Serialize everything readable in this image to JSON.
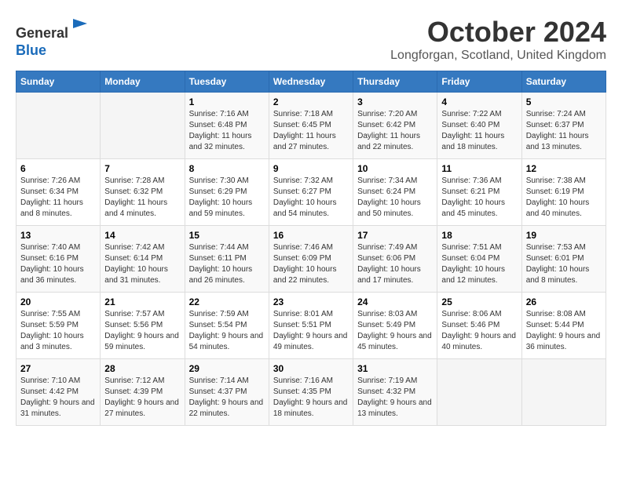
{
  "header": {
    "logo_line1": "General",
    "logo_line2": "Blue",
    "month_title": "October 2024",
    "location": "Longforgan, Scotland, United Kingdom"
  },
  "weekdays": [
    "Sunday",
    "Monday",
    "Tuesday",
    "Wednesday",
    "Thursday",
    "Friday",
    "Saturday"
  ],
  "weeks": [
    [
      {
        "day": "",
        "sunrise": "",
        "sunset": "",
        "daylight": ""
      },
      {
        "day": "",
        "sunrise": "",
        "sunset": "",
        "daylight": ""
      },
      {
        "day": "1",
        "sunrise": "Sunrise: 7:16 AM",
        "sunset": "Sunset: 6:48 PM",
        "daylight": "Daylight: 11 hours and 32 minutes."
      },
      {
        "day": "2",
        "sunrise": "Sunrise: 7:18 AM",
        "sunset": "Sunset: 6:45 PM",
        "daylight": "Daylight: 11 hours and 27 minutes."
      },
      {
        "day": "3",
        "sunrise": "Sunrise: 7:20 AM",
        "sunset": "Sunset: 6:42 PM",
        "daylight": "Daylight: 11 hours and 22 minutes."
      },
      {
        "day": "4",
        "sunrise": "Sunrise: 7:22 AM",
        "sunset": "Sunset: 6:40 PM",
        "daylight": "Daylight: 11 hours and 18 minutes."
      },
      {
        "day": "5",
        "sunrise": "Sunrise: 7:24 AM",
        "sunset": "Sunset: 6:37 PM",
        "daylight": "Daylight: 11 hours and 13 minutes."
      }
    ],
    [
      {
        "day": "6",
        "sunrise": "Sunrise: 7:26 AM",
        "sunset": "Sunset: 6:34 PM",
        "daylight": "Daylight: 11 hours and 8 minutes."
      },
      {
        "day": "7",
        "sunrise": "Sunrise: 7:28 AM",
        "sunset": "Sunset: 6:32 PM",
        "daylight": "Daylight: 11 hours and 4 minutes."
      },
      {
        "day": "8",
        "sunrise": "Sunrise: 7:30 AM",
        "sunset": "Sunset: 6:29 PM",
        "daylight": "Daylight: 10 hours and 59 minutes."
      },
      {
        "day": "9",
        "sunrise": "Sunrise: 7:32 AM",
        "sunset": "Sunset: 6:27 PM",
        "daylight": "Daylight: 10 hours and 54 minutes."
      },
      {
        "day": "10",
        "sunrise": "Sunrise: 7:34 AM",
        "sunset": "Sunset: 6:24 PM",
        "daylight": "Daylight: 10 hours and 50 minutes."
      },
      {
        "day": "11",
        "sunrise": "Sunrise: 7:36 AM",
        "sunset": "Sunset: 6:21 PM",
        "daylight": "Daylight: 10 hours and 45 minutes."
      },
      {
        "day": "12",
        "sunrise": "Sunrise: 7:38 AM",
        "sunset": "Sunset: 6:19 PM",
        "daylight": "Daylight: 10 hours and 40 minutes."
      }
    ],
    [
      {
        "day": "13",
        "sunrise": "Sunrise: 7:40 AM",
        "sunset": "Sunset: 6:16 PM",
        "daylight": "Daylight: 10 hours and 36 minutes."
      },
      {
        "day": "14",
        "sunrise": "Sunrise: 7:42 AM",
        "sunset": "Sunset: 6:14 PM",
        "daylight": "Daylight: 10 hours and 31 minutes."
      },
      {
        "day": "15",
        "sunrise": "Sunrise: 7:44 AM",
        "sunset": "Sunset: 6:11 PM",
        "daylight": "Daylight: 10 hours and 26 minutes."
      },
      {
        "day": "16",
        "sunrise": "Sunrise: 7:46 AM",
        "sunset": "Sunset: 6:09 PM",
        "daylight": "Daylight: 10 hours and 22 minutes."
      },
      {
        "day": "17",
        "sunrise": "Sunrise: 7:49 AM",
        "sunset": "Sunset: 6:06 PM",
        "daylight": "Daylight: 10 hours and 17 minutes."
      },
      {
        "day": "18",
        "sunrise": "Sunrise: 7:51 AM",
        "sunset": "Sunset: 6:04 PM",
        "daylight": "Daylight: 10 hours and 12 minutes."
      },
      {
        "day": "19",
        "sunrise": "Sunrise: 7:53 AM",
        "sunset": "Sunset: 6:01 PM",
        "daylight": "Daylight: 10 hours and 8 minutes."
      }
    ],
    [
      {
        "day": "20",
        "sunrise": "Sunrise: 7:55 AM",
        "sunset": "Sunset: 5:59 PM",
        "daylight": "Daylight: 10 hours and 3 minutes."
      },
      {
        "day": "21",
        "sunrise": "Sunrise: 7:57 AM",
        "sunset": "Sunset: 5:56 PM",
        "daylight": "Daylight: 9 hours and 59 minutes."
      },
      {
        "day": "22",
        "sunrise": "Sunrise: 7:59 AM",
        "sunset": "Sunset: 5:54 PM",
        "daylight": "Daylight: 9 hours and 54 minutes."
      },
      {
        "day": "23",
        "sunrise": "Sunrise: 8:01 AM",
        "sunset": "Sunset: 5:51 PM",
        "daylight": "Daylight: 9 hours and 49 minutes."
      },
      {
        "day": "24",
        "sunrise": "Sunrise: 8:03 AM",
        "sunset": "Sunset: 5:49 PM",
        "daylight": "Daylight: 9 hours and 45 minutes."
      },
      {
        "day": "25",
        "sunrise": "Sunrise: 8:06 AM",
        "sunset": "Sunset: 5:46 PM",
        "daylight": "Daylight: 9 hours and 40 minutes."
      },
      {
        "day": "26",
        "sunrise": "Sunrise: 8:08 AM",
        "sunset": "Sunset: 5:44 PM",
        "daylight": "Daylight: 9 hours and 36 minutes."
      }
    ],
    [
      {
        "day": "27",
        "sunrise": "Sunrise: 7:10 AM",
        "sunset": "Sunset: 4:42 PM",
        "daylight": "Daylight: 9 hours and 31 minutes."
      },
      {
        "day": "28",
        "sunrise": "Sunrise: 7:12 AM",
        "sunset": "Sunset: 4:39 PM",
        "daylight": "Daylight: 9 hours and 27 minutes."
      },
      {
        "day": "29",
        "sunrise": "Sunrise: 7:14 AM",
        "sunset": "Sunset: 4:37 PM",
        "daylight": "Daylight: 9 hours and 22 minutes."
      },
      {
        "day": "30",
        "sunrise": "Sunrise: 7:16 AM",
        "sunset": "Sunset: 4:35 PM",
        "daylight": "Daylight: 9 hours and 18 minutes."
      },
      {
        "day": "31",
        "sunrise": "Sunrise: 7:19 AM",
        "sunset": "Sunset: 4:32 PM",
        "daylight": "Daylight: 9 hours and 13 minutes."
      },
      {
        "day": "",
        "sunrise": "",
        "sunset": "",
        "daylight": ""
      },
      {
        "day": "",
        "sunrise": "",
        "sunset": "",
        "daylight": ""
      }
    ]
  ]
}
